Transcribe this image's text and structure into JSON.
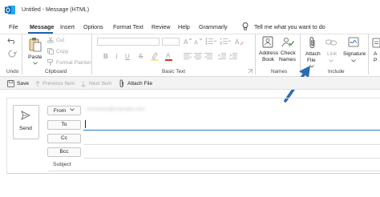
{
  "titlebar": {
    "title": "Untitled  -  Message (HTML)",
    "search_text": "Tell me what you want to do"
  },
  "menu_tabs": [
    "File",
    "Message",
    "Insert",
    "Options",
    "Format Text",
    "Review",
    "Help",
    "Grammarly"
  ],
  "ribbon": {
    "undo_label": "Undo",
    "clipboard": {
      "paste": "Paste",
      "cut": "Cut",
      "copy": "Copy",
      "format_painter": "Format Painter",
      "group": "Clipboard"
    },
    "basic_text": {
      "group": "Basic Text",
      "bold": "B",
      "italic": "I",
      "underline": "U",
      "strike": "S",
      "font_color": "A"
    },
    "names": {
      "address_book": [
        "Address",
        "Book"
      ],
      "check_names": [
        "Check",
        "Names"
      ],
      "group": "Names"
    },
    "include": {
      "attach_file": [
        "Attach",
        "File"
      ],
      "link": "Link",
      "signature": "Signature",
      "group": "Include"
    },
    "apps": [
      "A",
      "P"
    ]
  },
  "qat": {
    "save": "Save",
    "previous": "Previous Item",
    "next": "Next Item",
    "attach": "Attach File"
  },
  "compose": {
    "send": "Send",
    "from_label": "From",
    "from_value": "someone@example.com",
    "to_label": "To",
    "cc_label": "Cc",
    "bcc_label": "Bcc",
    "subject_label": "Subject"
  },
  "colors": {
    "accent": "#1f64b3",
    "active_tab_underline": "#1f64b3",
    "arrow": "#2a6cb4"
  }
}
